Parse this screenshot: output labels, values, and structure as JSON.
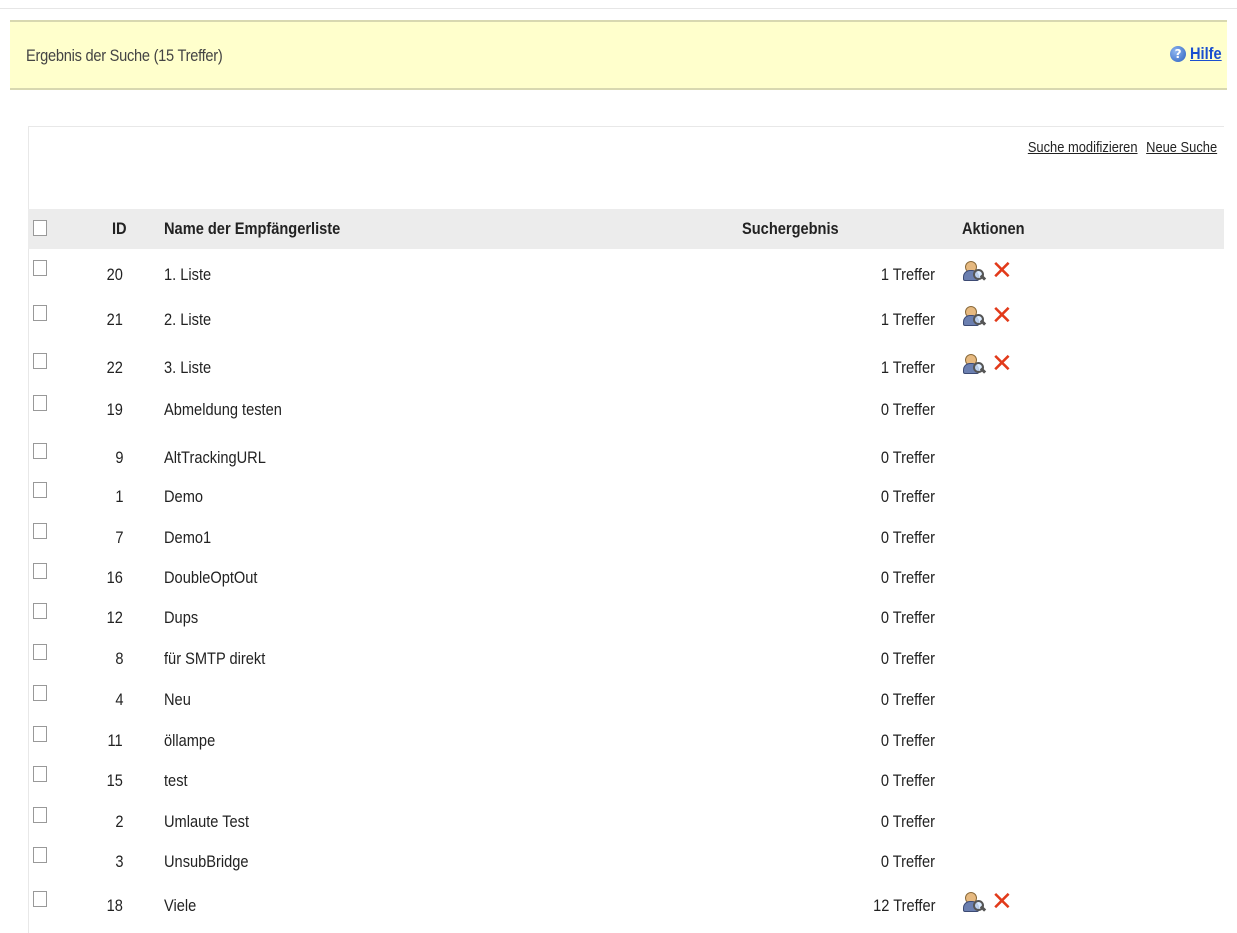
{
  "header": {
    "title": "Ergebnis der Suche (15 Treffer)",
    "help_label": "Hilfe"
  },
  "links": {
    "modify": "Suche modifizieren",
    "new": "Neue Suche"
  },
  "columns": {
    "id": "ID",
    "name": "Name der Empfängerliste",
    "result": "Suchergebnis",
    "actions": "Aktionen"
  },
  "rows": [
    {
      "id": "20",
      "name": "1. Liste",
      "result": "1 Treffer",
      "actions": true
    },
    {
      "id": "21",
      "name": "2. Liste",
      "result": "1 Treffer",
      "actions": true
    },
    {
      "id": "22",
      "name": "3. Liste",
      "result": "1 Treffer",
      "actions": true
    },
    {
      "id": "19",
      "name": "Abmeldung testen",
      "result": "0 Treffer",
      "actions": false
    },
    {
      "id": "9",
      "name": "AltTrackingURL",
      "result": "0 Treffer",
      "actions": false
    },
    {
      "id": "1",
      "name": "Demo",
      "result": "0 Treffer",
      "actions": false
    },
    {
      "id": "7",
      "name": "Demo1",
      "result": "0 Treffer",
      "actions": false
    },
    {
      "id": "16",
      "name": "DoubleOptOut",
      "result": "0 Treffer",
      "actions": false
    },
    {
      "id": "12",
      "name": "Dups",
      "result": "0 Treffer",
      "actions": false
    },
    {
      "id": "8",
      "name": "für SMTP direkt",
      "result": "0 Treffer",
      "actions": false
    },
    {
      "id": "4",
      "name": "Neu",
      "result": "0 Treffer",
      "actions": false
    },
    {
      "id": "11",
      "name": "öllampe",
      "result": "0 Treffer",
      "actions": false
    },
    {
      "id": "15",
      "name": "test",
      "result": "0 Treffer",
      "actions": false
    },
    {
      "id": "2",
      "name": "Umlaute Test",
      "result": "0 Treffer",
      "actions": false
    },
    {
      "id": "3",
      "name": "UnsubBridge",
      "result": "0 Treffer",
      "actions": false
    },
    {
      "id": "18",
      "name": "Viele",
      "result": "12 Treffer",
      "actions": true
    }
  ],
  "icons": {
    "view": "user-search-icon",
    "delete": "delete-x-icon",
    "help": "help-icon"
  },
  "colors": {
    "header_bg": "#ffffcc",
    "link": "#1a4fcf",
    "delete": "#e23a1a",
    "table_header_bg": "#ececec"
  }
}
